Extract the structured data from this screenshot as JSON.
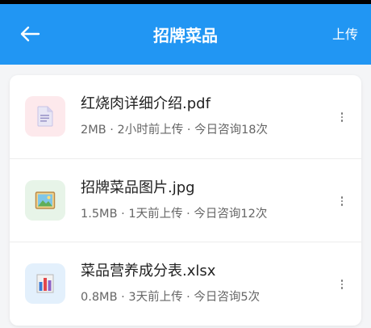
{
  "header": {
    "title": "招牌菜品",
    "upload_label": "上传",
    "back_icon": "arrow-left-icon",
    "background": "#2196f3"
  },
  "files": [
    {
      "name": "红烧肉详细介绍.pdf",
      "meta": "2MB · 2小时前上传 · 今日咨询18次",
      "icon": "pdf-document-icon",
      "icon_bg": "#fde9ec"
    },
    {
      "name": "招牌菜品图片.jpg",
      "meta": "1.5MB · 1天前上传 · 今日咨询12次",
      "icon": "image-file-icon",
      "icon_bg": "#e7f4e8"
    },
    {
      "name": "菜品营养成分表.xlsx",
      "meta": "0.8MB · 3天前上传 · 今日咨询5次",
      "icon": "bar-chart-file-icon",
      "icon_bg": "#e3f0fc"
    }
  ]
}
